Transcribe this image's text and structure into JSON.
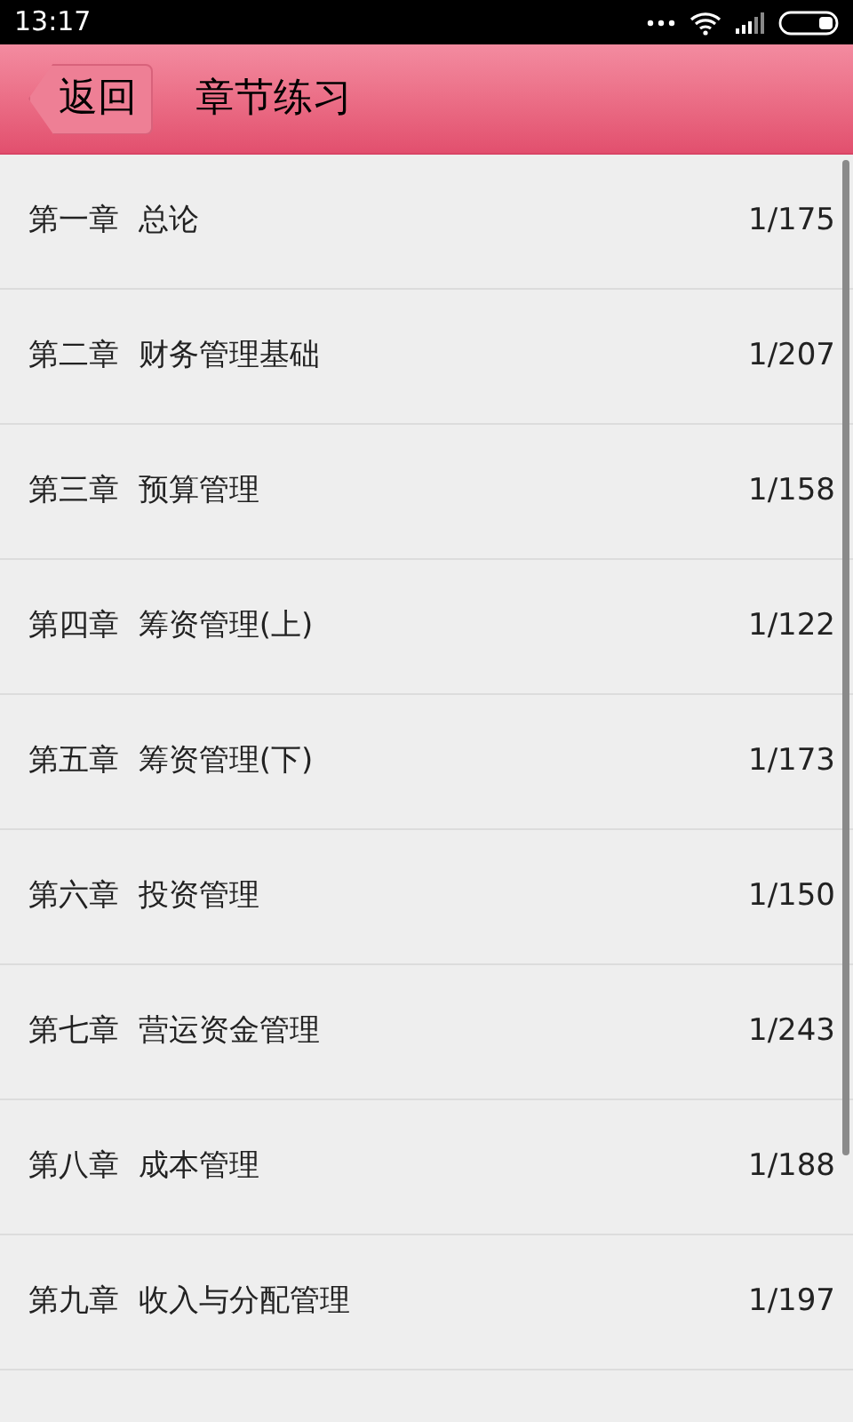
{
  "status_bar": {
    "time": "13:17"
  },
  "header": {
    "back_button": "返回",
    "title": "章节练习"
  },
  "chapters": [
    {
      "number": "第一章",
      "name": "总论",
      "progress": "1/175"
    },
    {
      "number": "第二章",
      "name": "财务管理基础",
      "progress": "1/207"
    },
    {
      "number": "第三章",
      "name": "预算管理",
      "progress": "1/158"
    },
    {
      "number": "第四章",
      "name": "筹资管理(上)",
      "progress": "1/122"
    },
    {
      "number": "第五章",
      "name": "筹资管理(下)",
      "progress": "1/173"
    },
    {
      "number": "第六章",
      "name": "投资管理",
      "progress": "1/150"
    },
    {
      "number": "第七章",
      "name": "营运资金管理",
      "progress": "1/243"
    },
    {
      "number": "第八章",
      "name": "成本管理",
      "progress": "1/188"
    },
    {
      "number": "第九章",
      "name": "收入与分配管理",
      "progress": "1/197"
    }
  ]
}
